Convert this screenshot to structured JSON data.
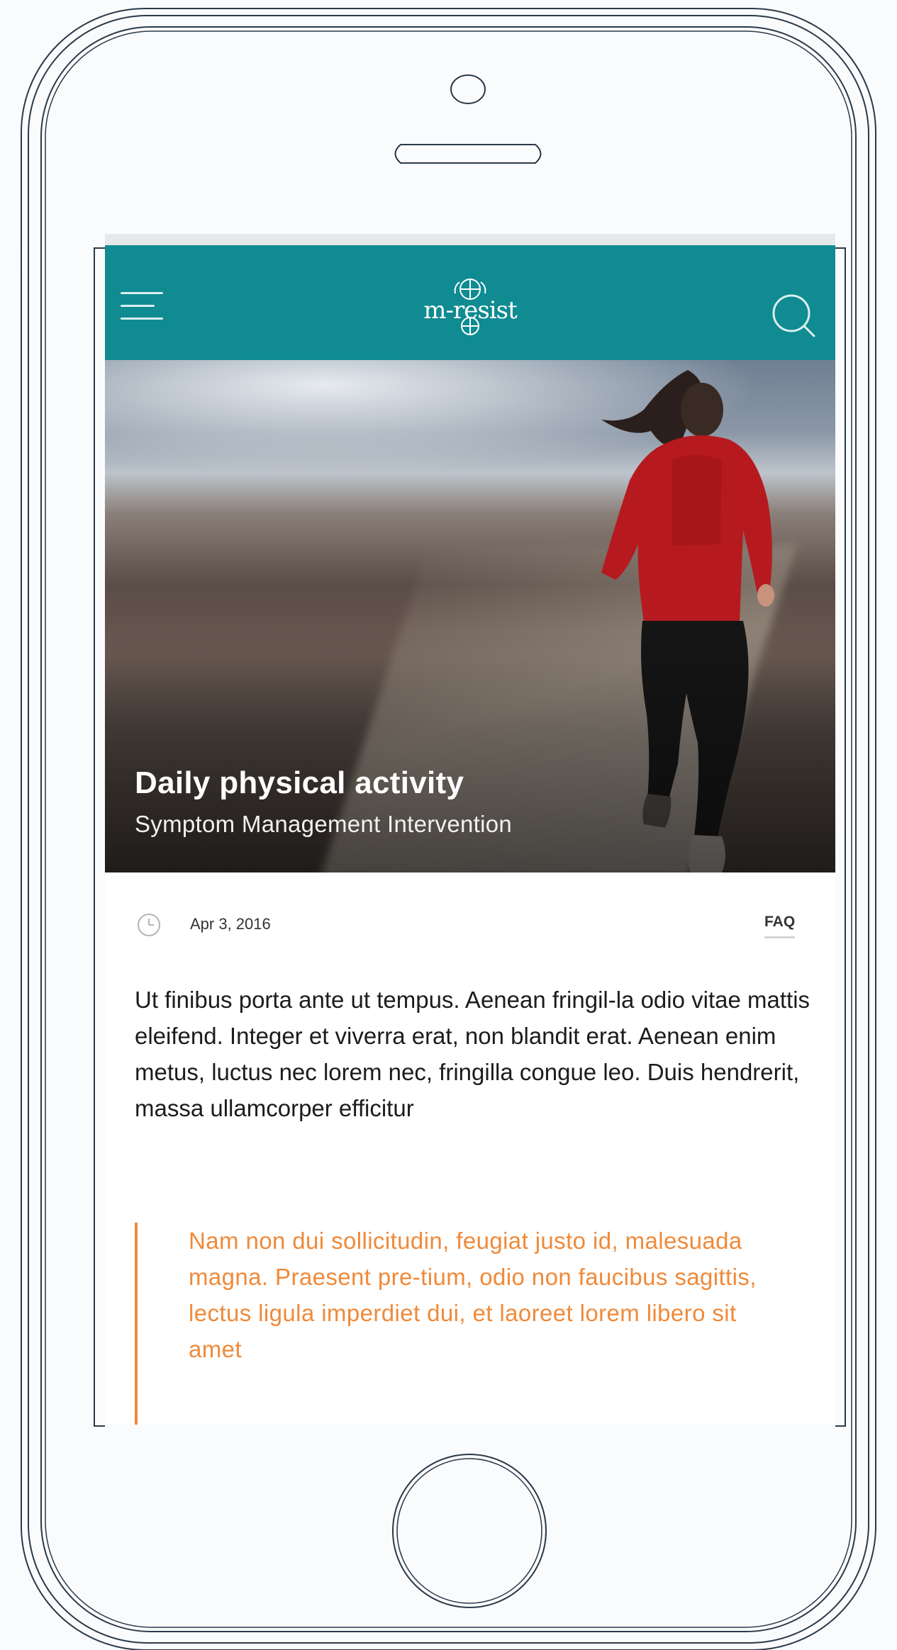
{
  "app": {
    "logo_text": "m-resist"
  },
  "header": {
    "menu_icon": "hamburger-menu-icon",
    "search_icon": "search-icon"
  },
  "hero": {
    "title": "Daily physical activity",
    "subtitle": "Symptom Management Intervention"
  },
  "meta": {
    "clock_icon": "clock-icon",
    "date": "Apr 3, 2016",
    "faq_label": "FAQ"
  },
  "article": {
    "body": "Ut finibus porta ante ut tempus. Aenean fringil-la odio vitae mattis eleifend. Integer et viverra erat, non blandit erat. Aenean enim metus, luctus nec lorem nec, fringilla congue leo. Duis hendrerit, massa ullamcorper efficitur",
    "quote": "Nam non dui sollicitudin, feugiat justo id, malesuada magna. Praesent pre-tium, odio non faucibus sagittis, lectus ligula imperdiet dui, et laoreet lorem libero sit amet"
  },
  "colors": {
    "app_bar": "#0f8b91",
    "quote_accent": "#ef8a3a",
    "phone_outline": "#2a3a4a"
  }
}
